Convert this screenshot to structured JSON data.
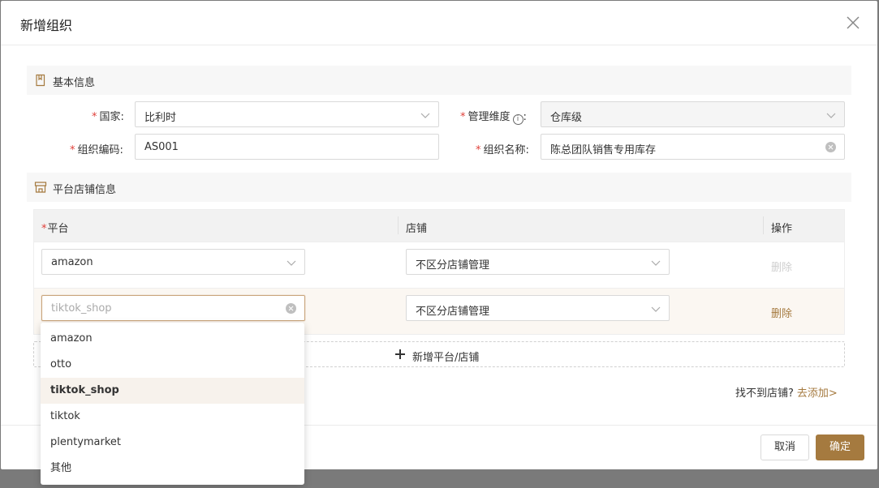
{
  "modal": {
    "title": "新增组织"
  },
  "basic_section": {
    "title": "基本信息"
  },
  "form": {
    "country": {
      "label": "国家:",
      "value": "比利时"
    },
    "dimension": {
      "label": "管理维度",
      "info_symbol": "i",
      "colon": ":",
      "value": "仓库级"
    },
    "org_code": {
      "label": "组织编码:",
      "value": "AS001"
    },
    "org_name": {
      "label": "组织名称:",
      "value": "陈总团队销售专用库存"
    }
  },
  "required_mark": "*",
  "platform_section": {
    "title": "平台店铺信息"
  },
  "table": {
    "headers": {
      "platform": "平台",
      "store": "店铺",
      "action": "操作"
    },
    "rows": [
      {
        "platform": "amazon",
        "store": "不区分店铺管理",
        "action": "删除"
      },
      {
        "platform_placeholder": "tiktok_shop",
        "store": "不区分店铺管理",
        "action": "删除"
      }
    ]
  },
  "add_row": {
    "label": "新增平台/店铺"
  },
  "hint": {
    "text": "找不到店铺?",
    "link": "去添加>"
  },
  "footer": {
    "cancel": "取消",
    "ok": "确定"
  },
  "dropdown": {
    "options": [
      "amazon",
      "otto",
      "tiktok_shop",
      "tiktok",
      "plentymarket",
      "其他"
    ],
    "selected_index": 2
  },
  "colors": {
    "accent": "#a57a3f",
    "required": "#e0403a"
  }
}
